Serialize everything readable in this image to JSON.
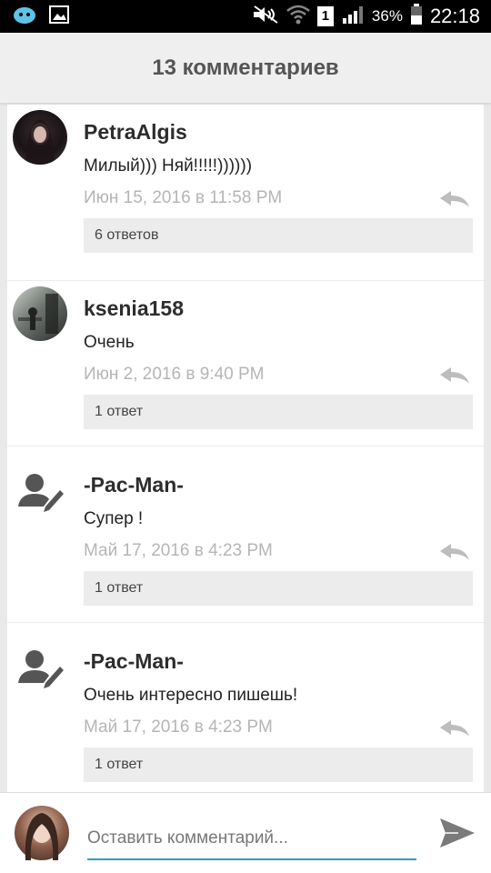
{
  "status_bar": {
    "battery_percent": "36%",
    "time": "22:18",
    "sim_label": "1",
    "icons": [
      "app-icon",
      "image-icon",
      "mute-icon",
      "wifi-icon",
      "sim-icon",
      "signal-icon",
      "battery-icon"
    ]
  },
  "header": {
    "title": "13 комментариев"
  },
  "comments": [
    {
      "author": "PetraAlgis",
      "text": "Милый))) Няй!!!!!))))))",
      "time": "Июн 15, 2016 в 11:58 PM",
      "replies": "6 ответов"
    },
    {
      "author": "ksenia158",
      "text": "Очень",
      "time": "Июн 2, 2016 в 9:40 PM",
      "replies": "1 ответ"
    },
    {
      "author": "-Pac-Man-",
      "text": "Супер !",
      "time": "Май 17, 2016 в 4:23 PM",
      "replies": "1 ответ"
    },
    {
      "author": "-Pac-Man-",
      "text": "Очень интересно пишешь!",
      "time": "Май 17, 2016 в 4:23 PM",
      "replies": "1 ответ"
    }
  ],
  "input": {
    "placeholder": "Оставить комментарий..."
  },
  "colors": {
    "accent": "#2aa1b8",
    "header_bg": "#efefef",
    "timestamp": "#b5b5b5"
  }
}
